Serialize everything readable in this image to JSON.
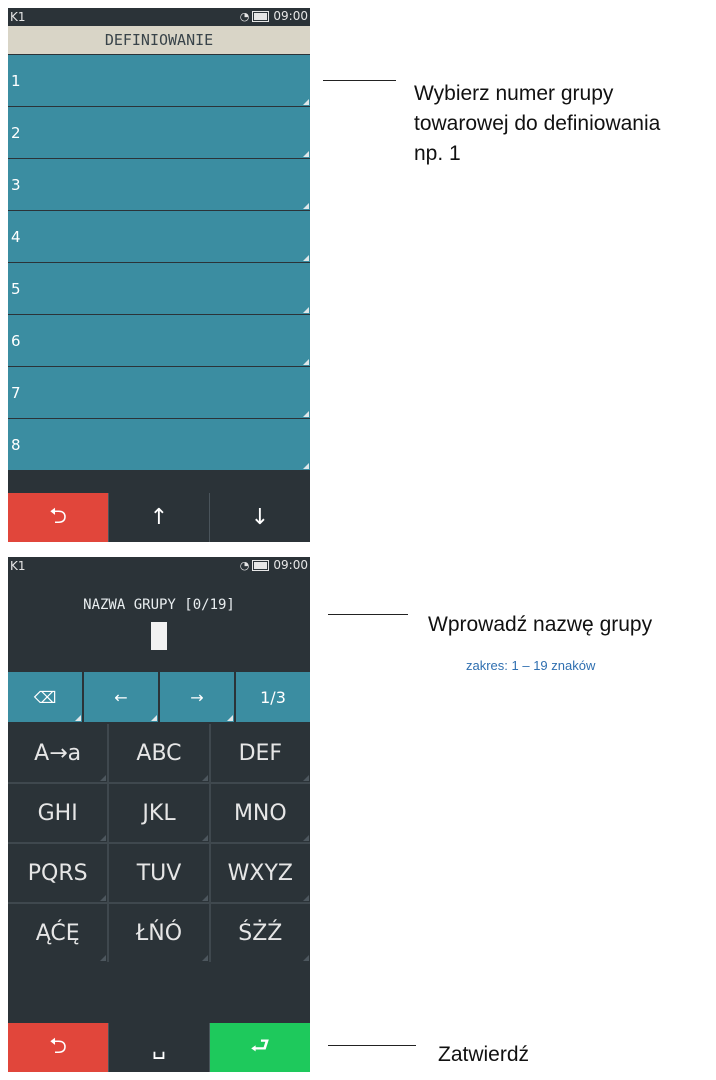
{
  "screen1": {
    "status_left": "K1",
    "status_time": "09:00",
    "title": "DEFINIOWANIE",
    "items": [
      {
        "label": "1"
      },
      {
        "label": "2"
      },
      {
        "label": "3"
      },
      {
        "label": "4"
      },
      {
        "label": "5"
      },
      {
        "label": "6"
      },
      {
        "label": "7"
      },
      {
        "label": "8"
      }
    ],
    "bottom": {
      "back": "⮌",
      "up": "↑",
      "down": "↓"
    }
  },
  "screen2": {
    "status_left": "K1",
    "status_time": "09:00",
    "prompt": "NAZWA GRUPY [0/19]",
    "edit_buttons": {
      "backspace": "⌫",
      "left": "←",
      "right": "→",
      "page": "1/3"
    },
    "keys": [
      "A→a",
      "ABC",
      "DEF",
      "GHI",
      "JKL",
      "MNO",
      "PQRS",
      "TUV",
      "WXYZ",
      "ĄĆĘ",
      "ŁŃÓ",
      "ŚŻŹ"
    ],
    "bottom": {
      "back": "⮌",
      "space": "␣",
      "enter": "⮐"
    }
  },
  "annotations": {
    "select_group_line1": "Wybierz numer grupy",
    "select_group_line2": "towarowej do definiowania",
    "select_group_line3": "np. 1",
    "enter_name": "Wprowadź nazwę grupy",
    "range": "zakres: 1 – 19 znaków",
    "confirm": "Zatwierdź"
  }
}
